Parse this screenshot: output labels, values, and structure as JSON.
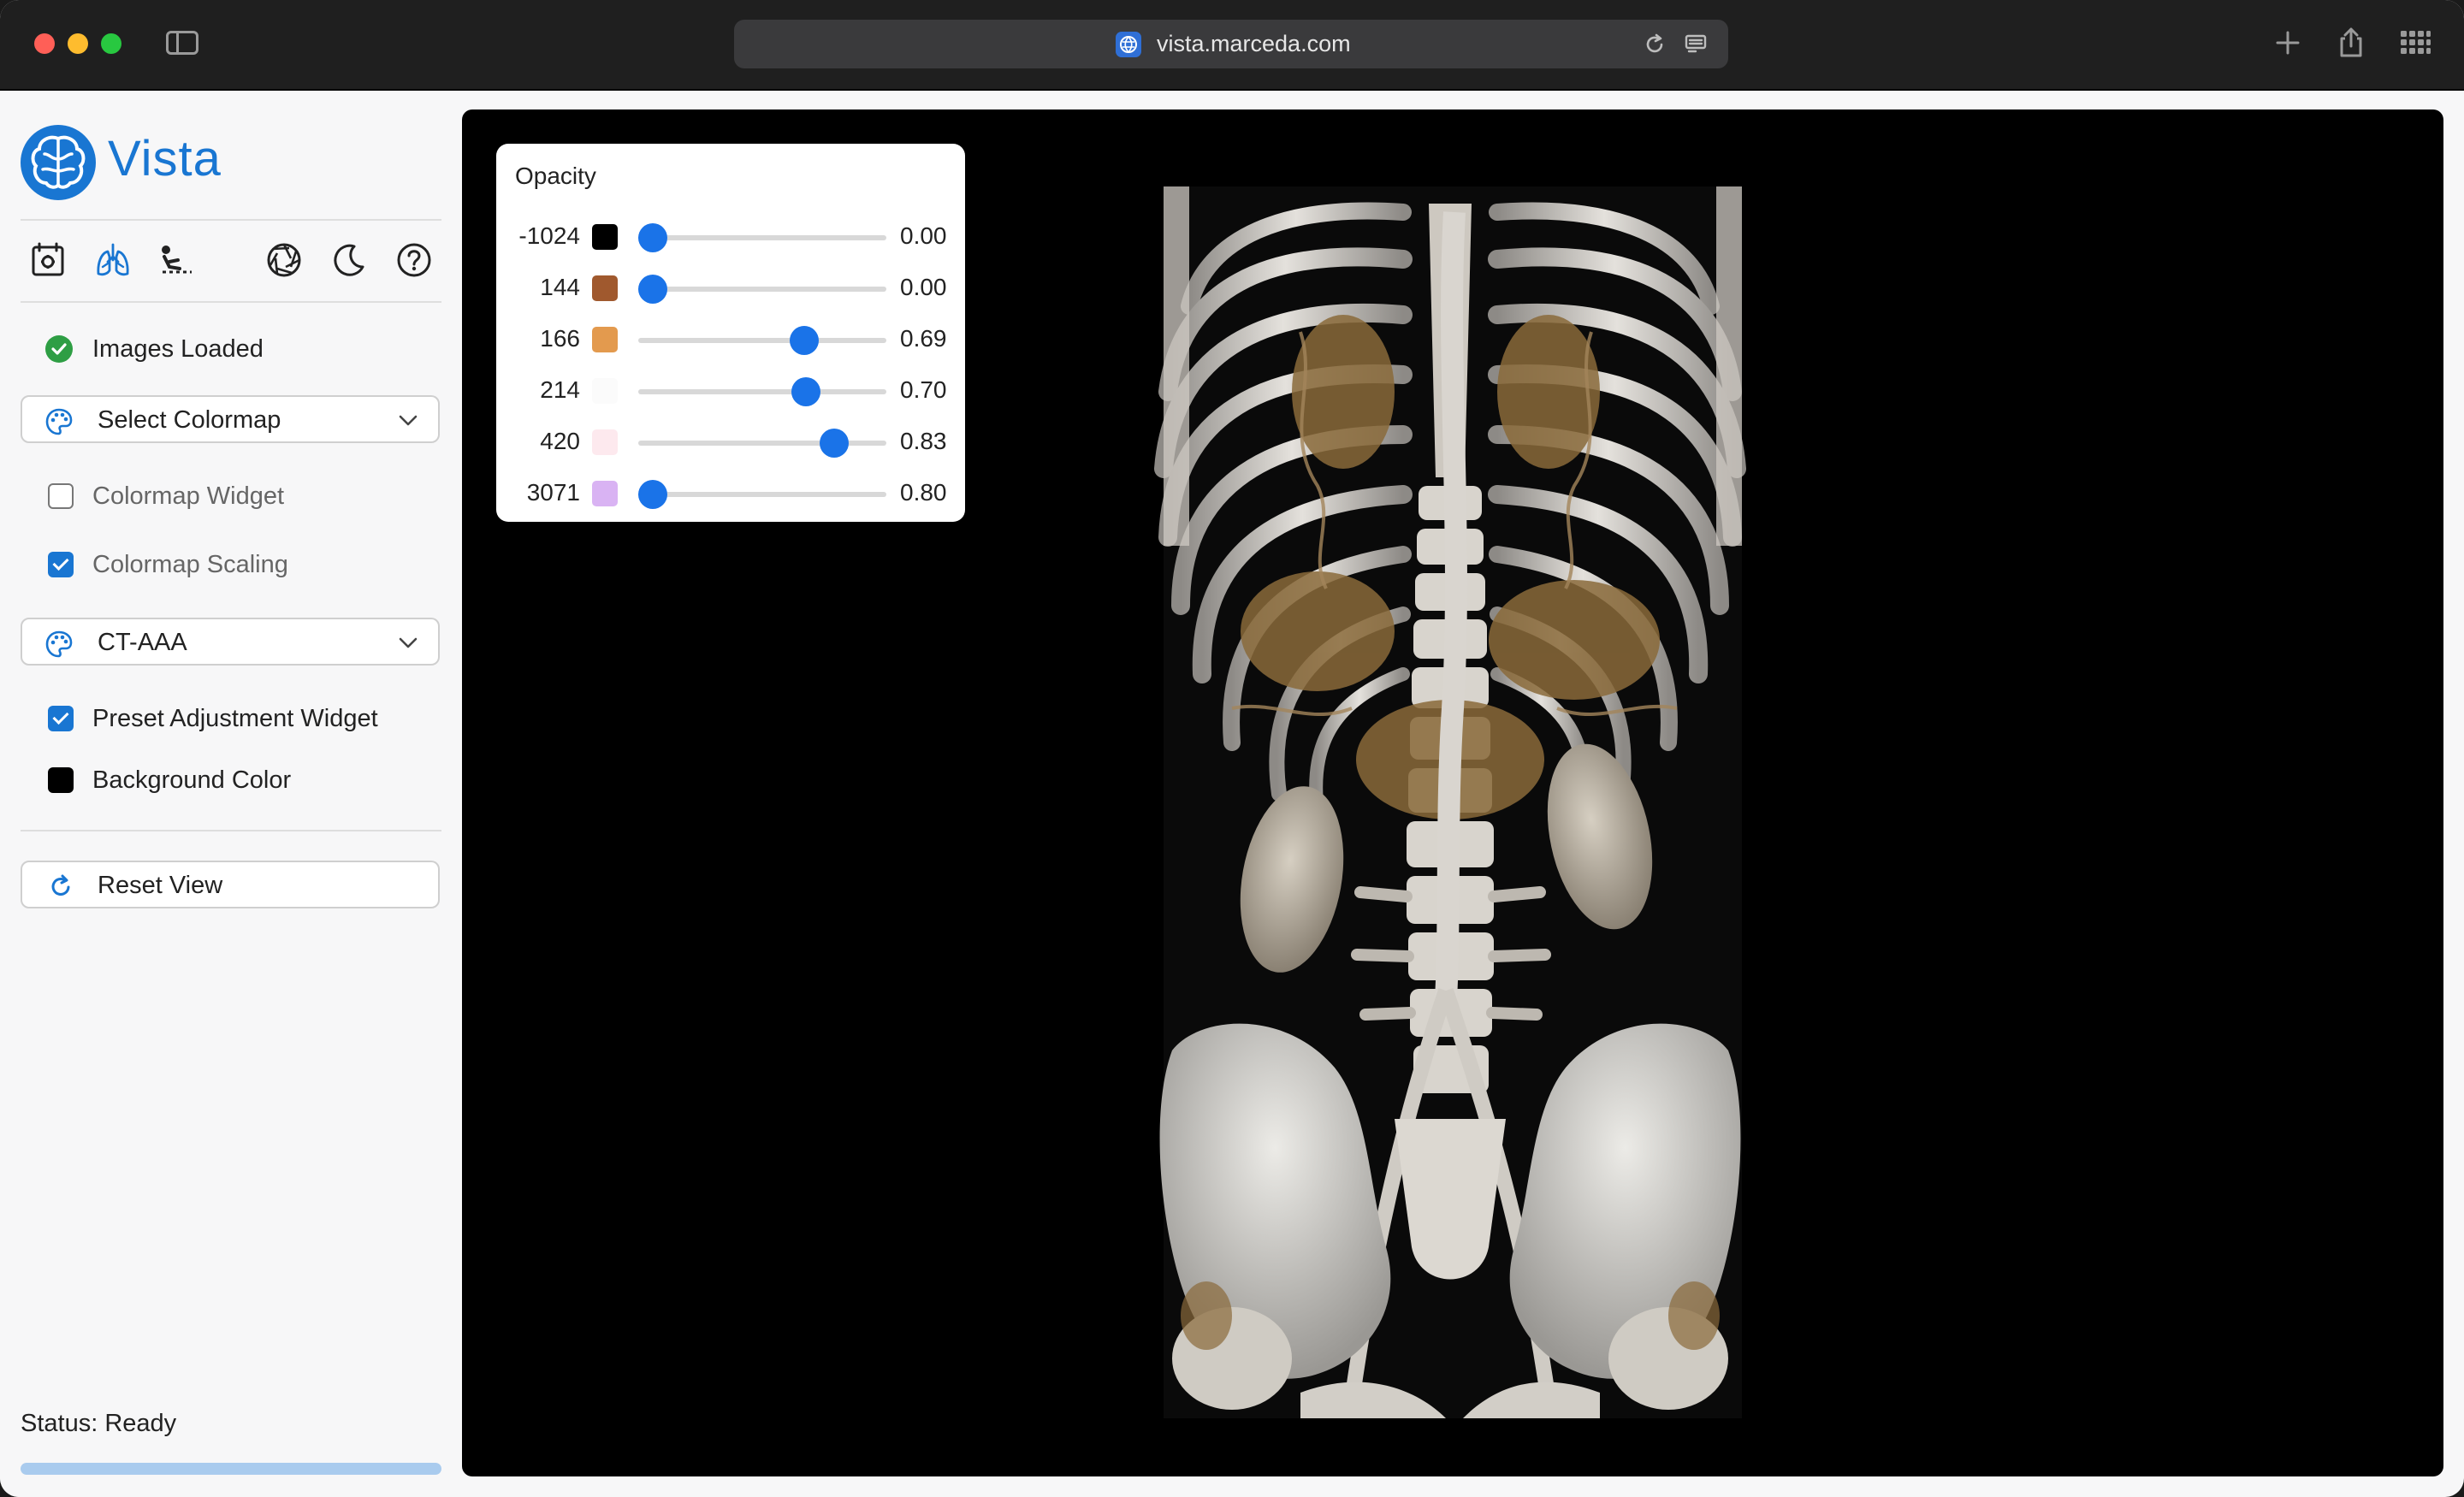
{
  "browser": {
    "url": "vista.marceda.com"
  },
  "app": {
    "brand": "Vista",
    "accent": "#1976d2",
    "toolbar_icons": [
      "gallery-icon",
      "lungs-icon",
      "skeleton-icon",
      "aperture-icon",
      "moon-icon",
      "help-icon"
    ]
  },
  "sidebar": {
    "images_loaded": "Images Loaded",
    "colormap_select": "Select Colormap",
    "colormap_widget": {
      "label": "Colormap Widget",
      "checked": false
    },
    "colormap_scaling": {
      "label": "Colormap Scaling",
      "checked": true
    },
    "preset_select": "CT-AAA",
    "preset_adjustment": {
      "label": "Preset Adjustment Widget",
      "checked": true
    },
    "background_color": {
      "label": "Background Color",
      "value": "#000000"
    },
    "reset_view": "Reset View",
    "status": "Status: Ready",
    "progress": 1.0
  },
  "opacity_widget": {
    "title": "Opacity",
    "rows": [
      {
        "point": "-1024",
        "color": "#000000",
        "value": "0.00",
        "level": 0.0
      },
      {
        "point": "144",
        "color": "#a0592e",
        "value": "0.00",
        "level": 0.0
      },
      {
        "point": "166",
        "color": "#e39a4e",
        "value": "0.69",
        "level": 0.69
      },
      {
        "point": "214",
        "color": "#fbfbfb",
        "value": "0.70",
        "level": 0.7
      },
      {
        "point": "420",
        "color": "#fde9ee",
        "value": "0.83",
        "level": 0.83
      },
      {
        "point": "3071",
        "color": "#d9b3f3",
        "value": "0.80",
        "level": 0.0
      }
    ]
  }
}
